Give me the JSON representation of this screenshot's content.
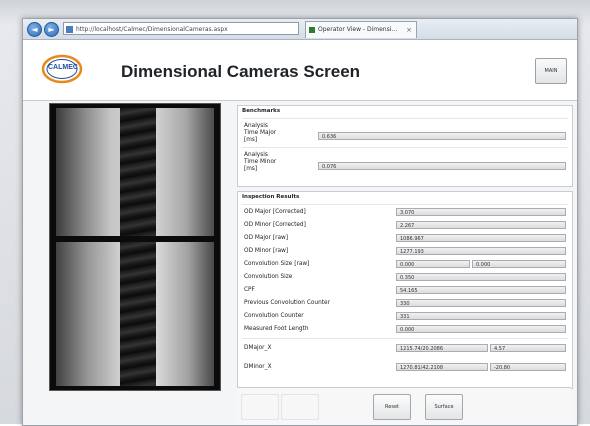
{
  "browser": {
    "address": "http://localhost/Calmec/DimensionalCameras.aspx",
    "tab_label": "Operator View - Dimensi...",
    "tab_close": "×",
    "back_glyph": "◄",
    "forward_glyph": "►"
  },
  "header": {
    "logo_text": "CALMEC",
    "title": "Dimensional Cameras Screen",
    "main_button": "MAIN"
  },
  "benchmarks": {
    "title": "Benchmarks",
    "rows": [
      {
        "label_lines": [
          "Analysis",
          "Time Major",
          "[ms]"
        ],
        "value": "0.636"
      },
      {
        "label_lines": [
          "Analysis",
          "Time Minor",
          "[ms]"
        ],
        "value": "0.076"
      }
    ]
  },
  "inspection": {
    "title": "Inspection Results",
    "rows": [
      {
        "label": "OD Major [Corrected]",
        "value": "3.070"
      },
      {
        "label": "OD Minor [Corrected]",
        "value": "2.267"
      },
      {
        "label": "OD Major [raw]",
        "value": "1086.967"
      },
      {
        "label": "OD Minor [raw]",
        "value": "1277.193"
      },
      {
        "label": "Convolution Size [raw]",
        "value": "0.000",
        "value2": "0.000"
      },
      {
        "label": "Convolution Size",
        "value": "0.350"
      },
      {
        "label": "CPF",
        "value": "54.165"
      },
      {
        "label": "Previous Convolution Counter",
        "value": "330"
      },
      {
        "label": "Convolution Counter",
        "value": "331"
      },
      {
        "label": "Measured Foot Length",
        "value": "0.000"
      },
      {
        "label": "DMajor_X",
        "value": "1215.74/20.2086",
        "value2": "4.57"
      },
      {
        "label": "DMinor_X",
        "value": "1270.81/42.2108",
        "value2": "-20.80"
      }
    ]
  },
  "buttons": {
    "reset": "Reset",
    "surface": "Surface"
  },
  "colors": {
    "logo_blue": "#1e4f9c",
    "logo_orange": "#e8891d"
  }
}
